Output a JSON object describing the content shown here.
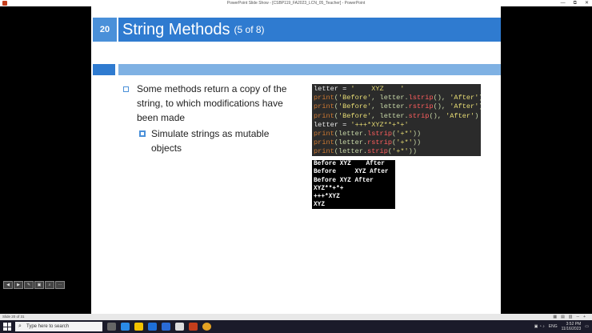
{
  "window": {
    "title": "PowerPoint Slide Show - [CSBP119_FA2023_LCN_05_Teacher] - PowerPoint",
    "controls": [
      "—",
      "⧉",
      "✕"
    ]
  },
  "slide": {
    "number": "20",
    "title": "String Methods",
    "title_suffix": "(5 of 8)",
    "bullets": [
      {
        "text": "Some methods return a copy of the string, to which modifications have been made"
      },
      {
        "text": "Simulate strings as mutable objects"
      }
    ],
    "code": [
      [
        {
          "t": "letter = ",
          "c": "c-white"
        },
        {
          "t": "'    XYZ    '",
          "c": "c-str"
        }
      ],
      [
        {
          "t": "print",
          "c": "c-kw"
        },
        {
          "t": "(",
          "c": "c-plain"
        },
        {
          "t": "'Before'",
          "c": "c-str"
        },
        {
          "t": ", letter.",
          "c": "c-plain"
        },
        {
          "t": "lstrip",
          "c": "c-method"
        },
        {
          "t": "(), ",
          "c": "c-plain"
        },
        {
          "t": "'After'",
          "c": "c-str"
        },
        {
          "t": ")",
          "c": "c-plain"
        }
      ],
      [
        {
          "t": "print",
          "c": "c-kw"
        },
        {
          "t": "(",
          "c": "c-plain"
        },
        {
          "t": "'Before'",
          "c": "c-str"
        },
        {
          "t": ", letter.",
          "c": "c-plain"
        },
        {
          "t": "rstrip",
          "c": "c-method"
        },
        {
          "t": "(), ",
          "c": "c-plain"
        },
        {
          "t": "'After'",
          "c": "c-str"
        },
        {
          "t": ")",
          "c": "c-plain"
        }
      ],
      [
        {
          "t": "print",
          "c": "c-kw"
        },
        {
          "t": "(",
          "c": "c-plain"
        },
        {
          "t": "'Before'",
          "c": "c-str"
        },
        {
          "t": ", letter.",
          "c": "c-plain"
        },
        {
          "t": "strip",
          "c": "c-method"
        },
        {
          "t": "(), ",
          "c": "c-plain"
        },
        {
          "t": "'After'",
          "c": "c-str"
        },
        {
          "t": ")",
          "c": "c-plain"
        }
      ],
      [
        {
          "t": "letter = ",
          "c": "c-white"
        },
        {
          "t": "'+++*XYZ**+*+'",
          "c": "c-str"
        }
      ],
      [
        {
          "t": "print",
          "c": "c-kw"
        },
        {
          "t": "(letter.",
          "c": "c-plain"
        },
        {
          "t": "lstrip",
          "c": "c-method"
        },
        {
          "t": "(",
          "c": "c-plain"
        },
        {
          "t": "'+*'",
          "c": "c-str"
        },
        {
          "t": "))",
          "c": "c-plain"
        }
      ],
      [
        {
          "t": "print",
          "c": "c-kw"
        },
        {
          "t": "(letter.",
          "c": "c-plain"
        },
        {
          "t": "rstrip",
          "c": "c-method"
        },
        {
          "t": "(",
          "c": "c-plain"
        },
        {
          "t": "'+*'",
          "c": "c-str"
        },
        {
          "t": "))",
          "c": "c-plain"
        }
      ],
      [
        {
          "t": "print",
          "c": "c-kw"
        },
        {
          "t": "(letter.",
          "c": "c-plain"
        },
        {
          "t": "strip",
          "c": "c-method"
        },
        {
          "t": "(",
          "c": "c-plain"
        },
        {
          "t": "'+*'",
          "c": "c-str"
        },
        {
          "t": "))",
          "c": "c-plain"
        }
      ]
    ],
    "output": [
      "Before XYZ    After",
      "Before     XYZ After",
      "Before XYZ After",
      "XYZ**+*+",
      "+++*XYZ",
      "XYZ"
    ]
  },
  "presenter_toolbar": [
    "◀",
    "▶",
    "✎",
    "▣",
    "⌕",
    "⋯"
  ],
  "statusbar": {
    "slide_info": "Slide 20 of 31",
    "tools": [
      "▦",
      "▤",
      "▥",
      "─",
      "+"
    ]
  },
  "taskbar": {
    "search_placeholder": "Type here to search",
    "tray_lang": "ENG",
    "time": "3:52 PM",
    "date": "11/16/2023"
  },
  "colors": {
    "accent": "#2f7bd0",
    "accent_light": "#7fb1e3",
    "code_bg": "#2b2b2b"
  }
}
